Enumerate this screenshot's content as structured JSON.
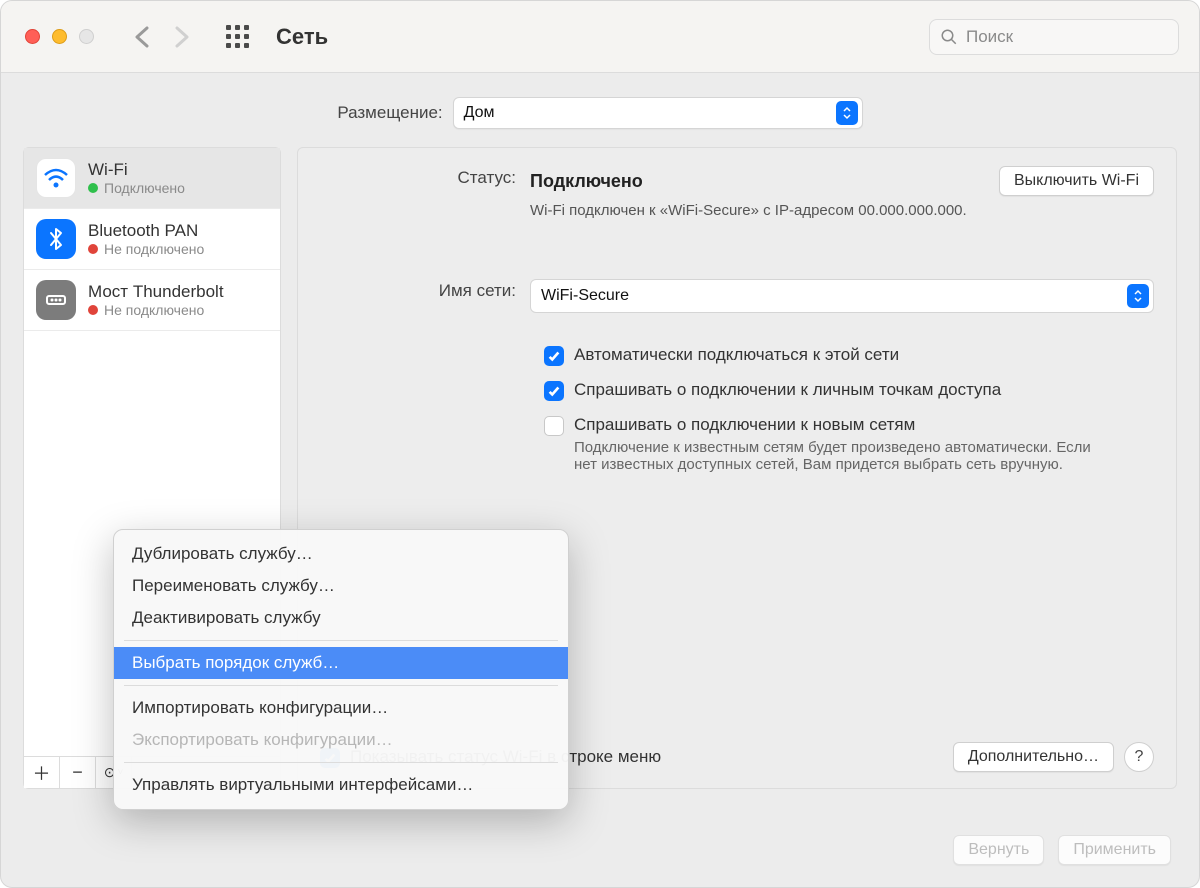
{
  "title": "Сеть",
  "search_placeholder": "Поиск",
  "location_label": "Размещение:",
  "location_value": "Дом",
  "services": [
    {
      "name": "Wi-Fi",
      "status": "Подключено",
      "status_color": "green",
      "icon_type": "wifi",
      "icon_bg": "white",
      "selected": true
    },
    {
      "name": "Bluetooth PAN",
      "status": "Не подключено",
      "status_color": "red",
      "icon_type": "bluetooth",
      "icon_bg": "blue",
      "selected": false
    },
    {
      "name": "Мост Thunderbolt",
      "status": "Не подключено",
      "status_color": "red",
      "icon_type": "thunderbolt",
      "icon_bg": "grey",
      "selected": false
    }
  ],
  "status_label": "Статус:",
  "status_value": "Подключено",
  "wifi_toggle_button": "Выключить Wi-Fi",
  "status_desc": "Wi-Fi подключен к «WiFi-Secure» с IP-адресом 00.000.000.000.",
  "network_label": "Имя сети:",
  "network_value": "WiFi-Secure",
  "check_auto_join": "Автоматически подключаться к этой сети",
  "check_ask_hotspots": "Спрашивать о подключении к личным точкам доступа",
  "check_ask_new": "Спрашивать о подключении к новым сетям",
  "check_ask_new_desc": "Подключение к известным сетям будет произведено автоматически. Если нет известных доступных сетей, Вам придется выбрать сеть вручную.",
  "check_show_menu": "Показывать статус Wi-Fi в строке меню",
  "advanced_button": "Дополнительно…",
  "revert_button": "Вернуть",
  "apply_button": "Применить",
  "context_menu": {
    "items": [
      {
        "label": "Дублировать службу…",
        "state": "normal"
      },
      {
        "label": "Переименовать службу…",
        "state": "normal"
      },
      {
        "label": "Деактивировать службу",
        "state": "normal"
      },
      {
        "label": "separator"
      },
      {
        "label": "Выбрать порядок служб…",
        "state": "highlighted"
      },
      {
        "label": "separator"
      },
      {
        "label": "Импортировать конфигурации…",
        "state": "normal"
      },
      {
        "label": "Экспортировать конфигурации…",
        "state": "disabled"
      },
      {
        "label": "separator"
      },
      {
        "label": "Управлять виртуальными интерфейсами…",
        "state": "normal"
      }
    ]
  }
}
